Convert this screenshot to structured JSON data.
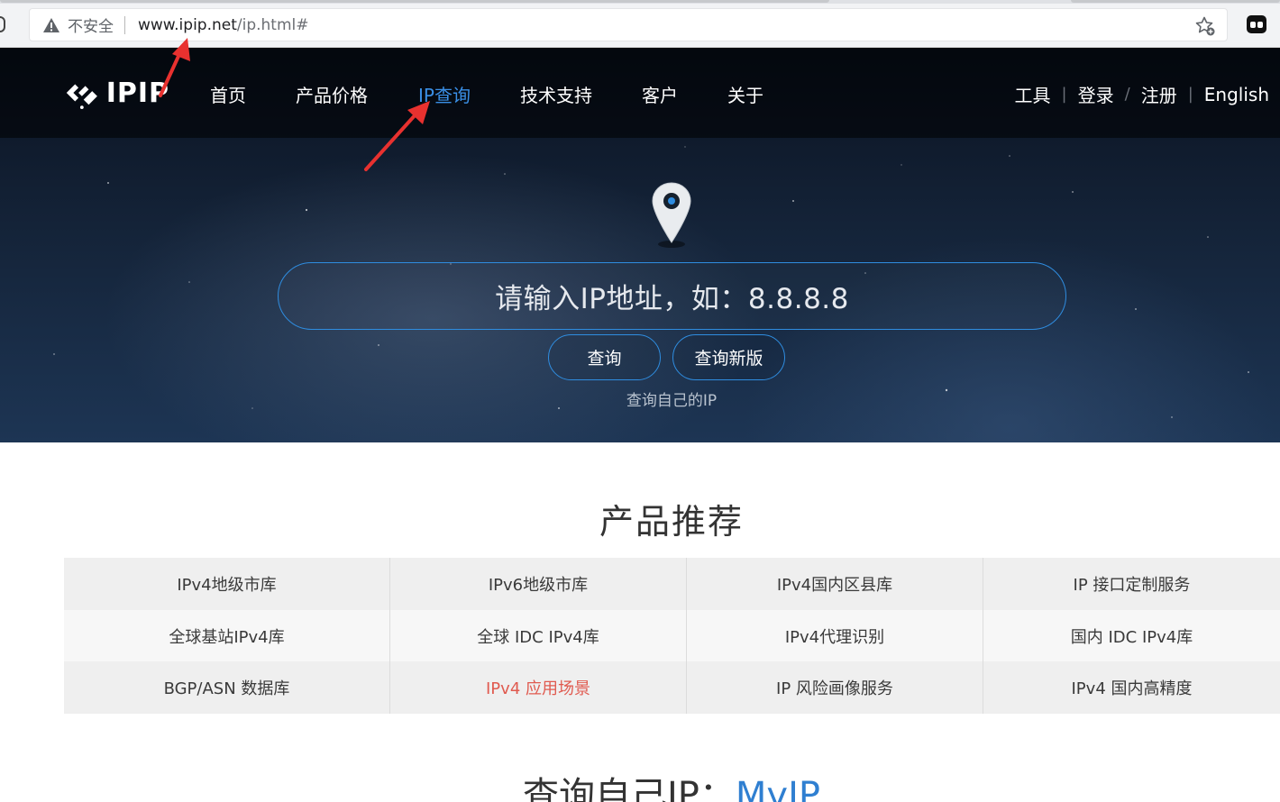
{
  "browser": {
    "insecure_label": "不安全",
    "url_host": "www.ipip.net",
    "url_path": "/ip.html#"
  },
  "nav": {
    "logo_text": "IPIP",
    "items": [
      {
        "label": "首页"
      },
      {
        "label": "产品价格"
      },
      {
        "label": "IP查询"
      },
      {
        "label": "技术支持"
      },
      {
        "label": "客户"
      },
      {
        "label": "关于"
      }
    ],
    "active_index": 2,
    "tools": "工具",
    "login": "登录",
    "slash": "/",
    "register": "注册",
    "english": "English",
    "bar": "|",
    "active_color": "#3a8fe6"
  },
  "hero": {
    "search_placeholder": "请输入IP地址，如：8.8.8.8",
    "query_button": "查询",
    "query_new_button": "查询新版",
    "myip_link": "查询自己的IP",
    "accent_color": "#2f8de0"
  },
  "products": {
    "title": "产品推荐",
    "rows": [
      [
        "IPv4地级市库",
        "IPv6地级市库",
        "IPv4国内区县库",
        "IP 接口定制服务"
      ],
      [
        "全球基站IPv4库",
        "全球 IDC IPv4库",
        "IPv4代理识别",
        "国内 IDC IPv4库"
      ],
      [
        "BGP/ASN 数据库",
        "IPv4 应用场景",
        "IP 风险画像服务",
        "IPv4 国内高精度"
      ]
    ],
    "highlight_color": "#e05a4f"
  },
  "myip_section": {
    "title_prefix": "查询自己IP：",
    "title_accent": "MyIP"
  },
  "annotation_color": "#e8312f"
}
